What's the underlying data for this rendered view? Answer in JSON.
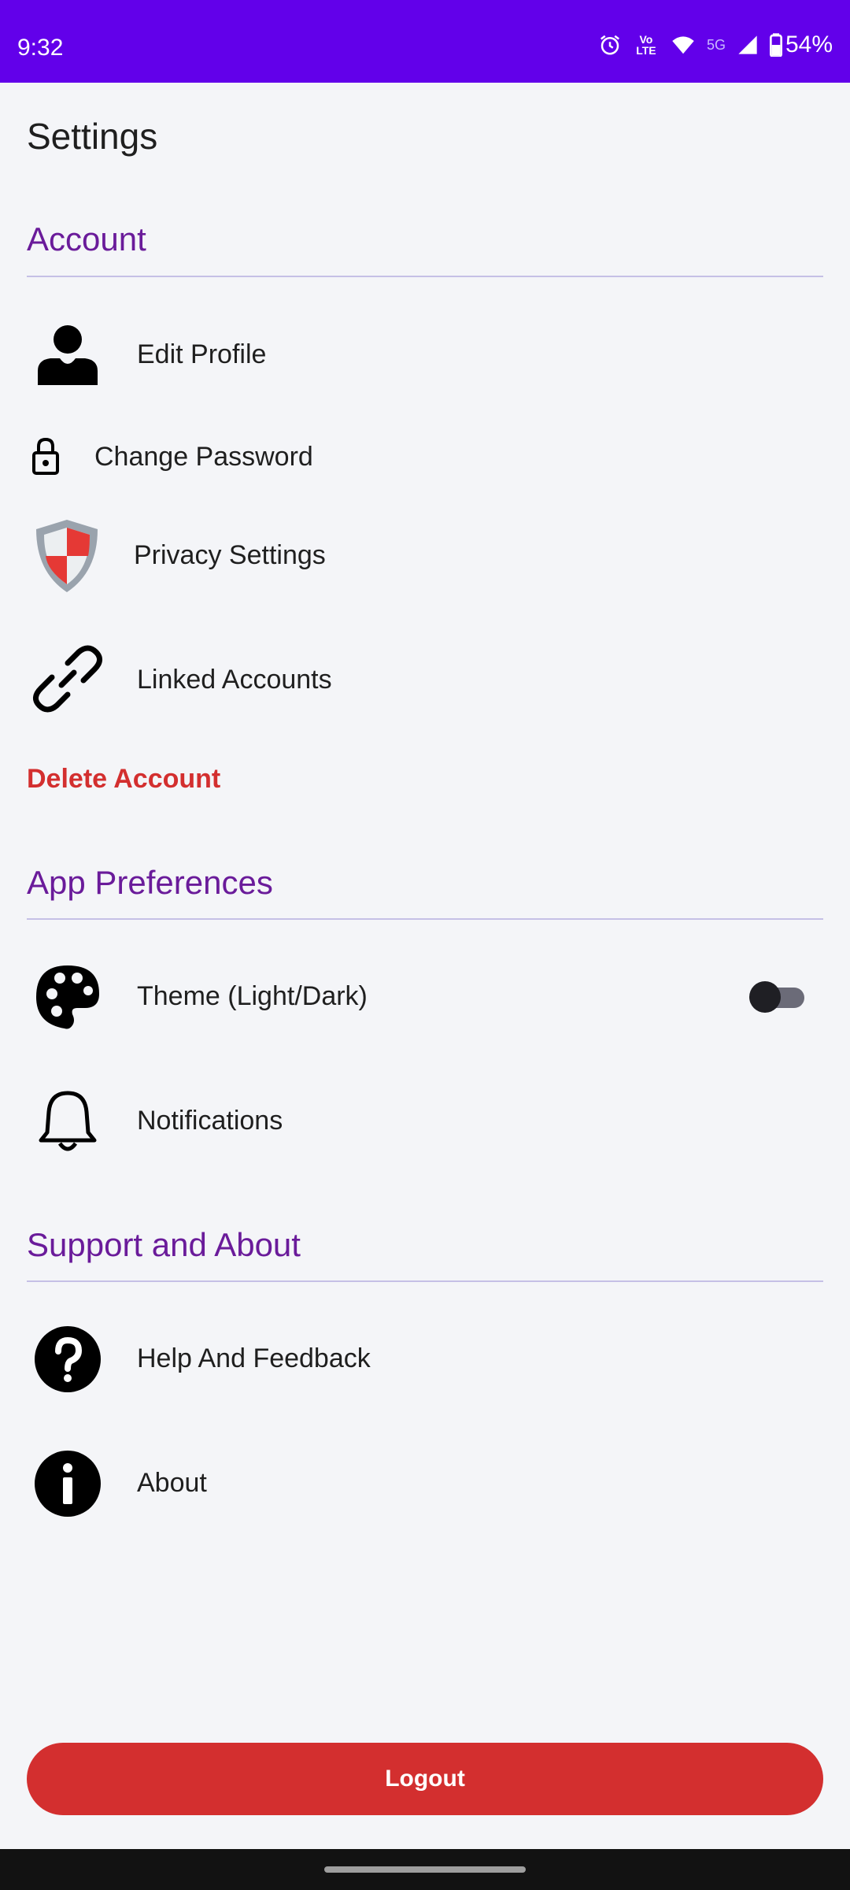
{
  "status_bar": {
    "time": "9:32",
    "network": "5G",
    "volte": "Vo LTE",
    "battery": "54%"
  },
  "page": {
    "title": "Settings"
  },
  "sections": {
    "account": {
      "title": "Account",
      "items": {
        "edit_profile": {
          "label": "Edit Profile",
          "icon": "person-icon"
        },
        "change_password": {
          "label": "Change Password",
          "icon": "lock-icon"
        },
        "privacy": {
          "label": "Privacy Settings",
          "icon": "shield-icon"
        },
        "linked": {
          "label": "Linked Accounts",
          "icon": "link-icon"
        }
      },
      "delete_label": "Delete Account"
    },
    "preferences": {
      "title": "App Preferences",
      "items": {
        "theme": {
          "label": "Theme (Light/Dark)",
          "icon": "palette-icon",
          "toggle_on": false
        },
        "notifications": {
          "label": "Notifications",
          "icon": "bell-icon"
        }
      }
    },
    "support": {
      "title": "Support and About",
      "items": {
        "help": {
          "label": "Help And Feedback",
          "icon": "question-icon"
        },
        "about": {
          "label": "About",
          "icon": "info-icon"
        }
      }
    }
  },
  "logout_label": "Logout",
  "colors": {
    "status_bar": "#6200ea",
    "section_title": "#6a1b9a",
    "danger": "#d32f2f",
    "background": "#f4f5f8"
  }
}
